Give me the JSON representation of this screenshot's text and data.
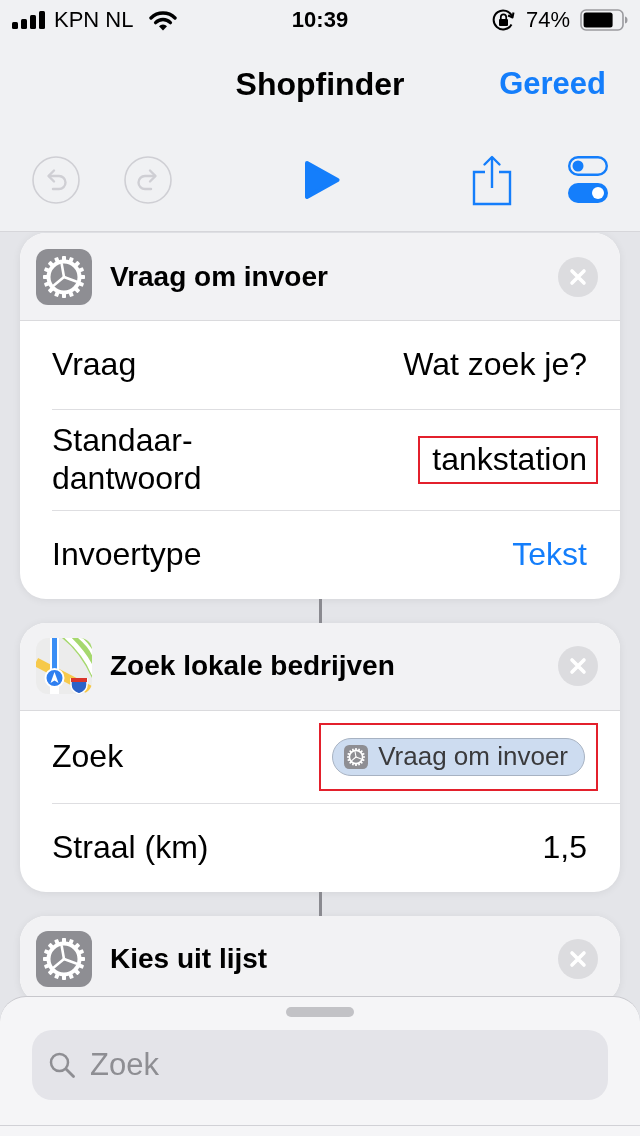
{
  "status_bar": {
    "carrier": "KPN NL",
    "time": "10:39",
    "battery": "74%"
  },
  "nav_bar": {
    "title": "Shopfinder",
    "done_button": "Gereed"
  },
  "toolbar": [
    {
      "kind": "undo",
      "disabled": true
    },
    {
      "kind": "redo",
      "disabled": true
    },
    {
      "kind": "play",
      "disabled": false
    },
    {
      "kind": "share",
      "disabled": false
    },
    {
      "kind": "settings",
      "disabled": false
    }
  ],
  "actions": [
    {
      "kind": "script",
      "title": "Vraag om invoer",
      "rows": [
        {
          "kind": "text",
          "label": "Vraag",
          "value": "Wat zoek je?",
          "highlighted": false
        },
        {
          "kind": "text",
          "label": "Standaar-dantwoord",
          "value": "tankstation",
          "highlighted": true
        },
        {
          "kind": "option",
          "label": "Invoertype",
          "value": "Tekst",
          "highlighted": false
        }
      ]
    },
    {
      "kind": "maps",
      "title": "Zoek lokale bedrijven",
      "rows": [
        {
          "kind": "variable",
          "label": "Zoek",
          "value": "Vraag om invoer",
          "highlighted": true
        },
        {
          "kind": "text",
          "label": "Straal (km)",
          "value": "1,5",
          "highlighted": false
        }
      ]
    },
    {
      "kind": "script",
      "title": "Kies uit lijst"
    }
  ],
  "search": {
    "placeholder": "Zoek"
  }
}
